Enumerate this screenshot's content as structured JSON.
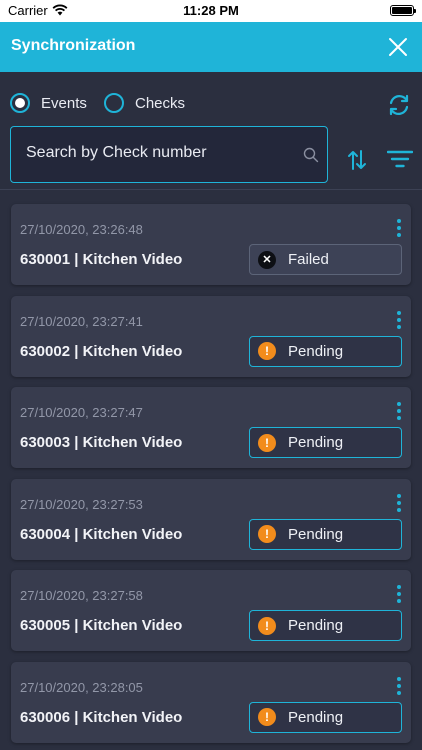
{
  "status_bar": {
    "carrier": "Carrier",
    "time": "11:28 PM"
  },
  "header": {
    "title": "Synchronization"
  },
  "filters": {
    "options": [
      {
        "label": "Events",
        "selected": true
      },
      {
        "label": "Checks",
        "selected": false
      }
    ]
  },
  "search": {
    "placeholder": "Search by Check number",
    "value": ""
  },
  "colors": {
    "accent": "#1fb4d8",
    "background": "#2b2f3f",
    "card": "#383c4e",
    "pending": "#f28c1c",
    "failed": "#0d0f14"
  },
  "icons": [
    "wifi-icon",
    "battery-icon",
    "close-icon",
    "refresh-icon",
    "search-icon",
    "sort-icon",
    "filter-icon",
    "more-vertical-icon",
    "failed-x-icon",
    "pending-exclamation-icon"
  ],
  "items": [
    {
      "timestamp": "27/10/2020, 23:26:48",
      "title": "630001  |  Kitchen Video",
      "status": "Failed",
      "status_type": "failed"
    },
    {
      "timestamp": "27/10/2020, 23:27:41",
      "title": "630002  |  Kitchen Video",
      "status": "Pending",
      "status_type": "pending"
    },
    {
      "timestamp": "27/10/2020, 23:27:47",
      "title": "630003  |  Kitchen Video",
      "status": "Pending",
      "status_type": "pending"
    },
    {
      "timestamp": "27/10/2020, 23:27:53",
      "title": "630004  |  Kitchen Video",
      "status": "Pending",
      "status_type": "pending"
    },
    {
      "timestamp": "27/10/2020, 23:27:58",
      "title": "630005  |  Kitchen Video",
      "status": "Pending",
      "status_type": "pending"
    },
    {
      "timestamp": "27/10/2020, 23:28:05",
      "title": "630006  |  Kitchen Video",
      "status": "Pending",
      "status_type": "pending"
    }
  ]
}
